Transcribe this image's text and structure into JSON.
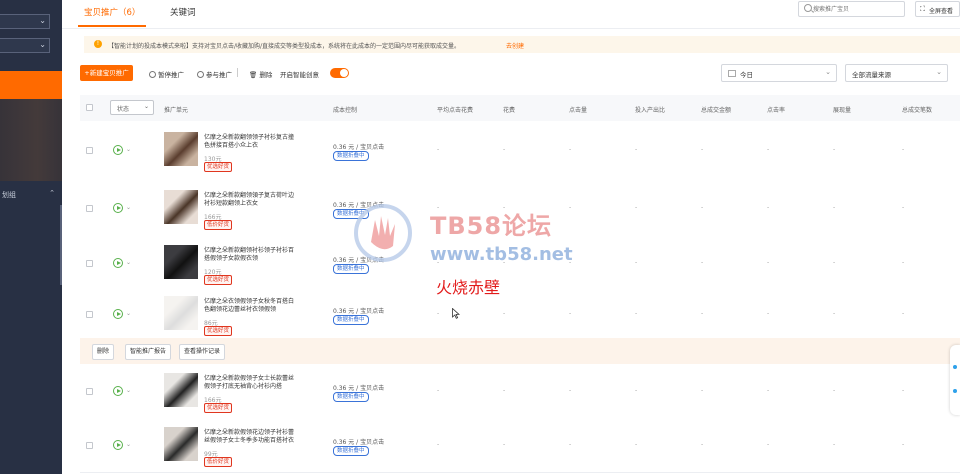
{
  "tabs": {
    "active": "宝贝推广（6）",
    "keywords": "关键词"
  },
  "search": {
    "placeholder": "搜索推广宝贝"
  },
  "fullscreen_label": "全屏查看",
  "notice": {
    "text": "【智能计划的投成本模式来啦】支持对宝贝点击/收藏加购/直接成交等类型投成本，系统将在此成本的一定范围内尽可能获取成交量。",
    "link": "去创建"
  },
  "toolbar": {
    "new_button": "+新建宝贝推广",
    "pause": "暂停推广",
    "join": "参与推广",
    "delete": "删除",
    "smart_label": "开启智能创意",
    "smart_on": true,
    "date_select": "今日",
    "source_select": "全部流量来源"
  },
  "table": {
    "status_select": "状态",
    "headers": [
      "推广单元",
      "成本控制",
      "平均点击花费",
      "花费",
      "点击量",
      "投入产出比",
      "总成交金额",
      "点击率",
      "展现量",
      "总成交笔数"
    ],
    "rows": [
      {
        "title": "亿摩之朵新款翻领领子衬衫复古撞色拼接百搭小众上衣",
        "price": "130元",
        "tag": "优选好货",
        "bid": "0.36 元 / 宝贝点击",
        "bid_btn": "数据折叠中"
      },
      {
        "title": "亿摩之朵新款翻领領子复古荷叶边衬衫短款翻领上衣女",
        "price": "166元",
        "tag": "低价好货",
        "bid": "0.36 元 / 宝贝点击",
        "bid_btn": "数据折叠中"
      },
      {
        "title": "亿摩之朵新款翻领衬衫领子衬衫百搭假领子女款假衣领",
        "price": "120元",
        "tag": "优选好货",
        "bid": "0.36 元 / 宝贝点击",
        "bid_btn": "数据折叠中"
      },
      {
        "title": "亿摩之朵衣领假领子女秋冬百搭白色翻领花边蕾丝衬衣领假领",
        "price": "86元",
        "tag": "优选好货",
        "bid": "0.36 元 / 宝贝点击",
        "bid_btn": "数据折叠中"
      },
      {
        "title": "亿摩之朵新款假领子女士长款蕾丝假领子打底无袖背心衬衫内搭",
        "price": "166元",
        "tag": "优选好货",
        "bid": "0.36 元 / 宝贝点击",
        "bid_btn": "数据折叠中"
      },
      {
        "title": "亿摩之朵新款假领花边领子衬衫蕾丝假领子女士冬季多功能百搭衬衣",
        "price": "99元",
        "tag": "低价好货",
        "bid": "0.36 元 / 宝贝点击",
        "bid_btn": "数据折叠中"
      }
    ],
    "empty_cell": "-"
  },
  "bulk_actions": [
    "删除",
    "智能推广报告",
    "查看操作记录"
  ],
  "sidebar_group": "划组",
  "watermark": {
    "title": "TB58论坛",
    "url": "www.tb58.net"
  },
  "annotation": "火烧赤壁",
  "colors": {
    "accent": "#ff6a00",
    "sidebar": "#283044",
    "notice_bg": "#fdf6ea",
    "tag_red": "#e0361f",
    "link_blue": "#3a73d8"
  }
}
